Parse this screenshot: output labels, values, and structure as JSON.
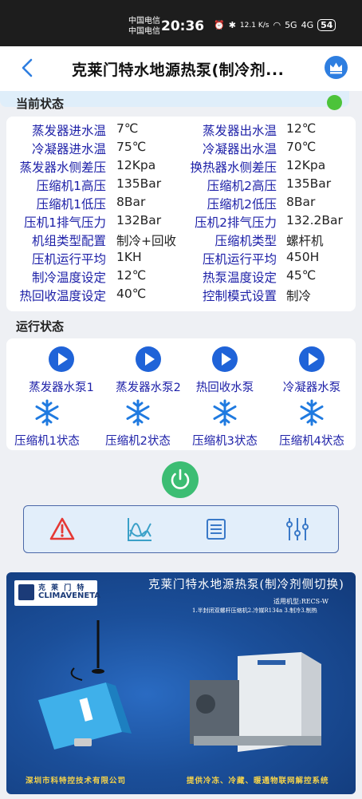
{
  "status_bar": {
    "carrier1": "中国电信",
    "carrier2": "中国电信",
    "time": "20:36",
    "net_speed": "12.1 K/s",
    "signal1": "5G",
    "signal2": "4G",
    "battery": "54"
  },
  "header": {
    "title": "克莱门特水地源热泵(制冷剂..."
  },
  "current_status": {
    "heading": "当前状态",
    "indicator_color": "#4cc33a",
    "rows": [
      {
        "l_label": "蒸发器进水温",
        "l_value": "7℃",
        "r_label": "蒸发器出水温",
        "r_value": "12℃"
      },
      {
        "l_label": "冷凝器进水温",
        "l_value": "75℃",
        "r_label": "冷凝器出水温",
        "r_value": "70℃"
      },
      {
        "l_label": "蒸发器水侧差压",
        "l_value": "12Kpa",
        "r_label": "换热器水侧差压",
        "r_value": "12Kpa"
      },
      {
        "l_label": "压缩机1高压",
        "l_value": "135Bar",
        "r_label": "压缩机2高压",
        "r_value": "135Bar"
      },
      {
        "l_label": "压缩机1低压",
        "l_value": "8Bar",
        "r_label": "压缩机2低压",
        "r_value": "8Bar"
      },
      {
        "l_label": "压机1排气压力",
        "l_value": "132Bar",
        "r_label": "压机2排气压力",
        "r_value": "132.2Bar"
      },
      {
        "l_label": "机组类型配置",
        "l_value": "制冷+回收",
        "r_label": "压缩机类型",
        "r_value": "螺杆机"
      },
      {
        "l_label": "压机运行平均",
        "l_value": "1KH",
        "r_label": "压机运行平均",
        "r_value": "450H"
      },
      {
        "l_label": "制冷温度设定",
        "l_value": "12℃",
        "r_label": "热泵温度设定",
        "r_value": "45℃"
      },
      {
        "l_label": "热回收温度设定",
        "l_value": "40℃",
        "r_label": "控制模式设置",
        "r_value": "制冷"
      }
    ]
  },
  "run_status": {
    "heading": "运行状态",
    "pumps": [
      {
        "label": "蒸发器水泵1",
        "icon": "play-icon"
      },
      {
        "label": "蒸发器水泵2",
        "icon": "play-icon"
      },
      {
        "label": "热回收水泵",
        "icon": "play-icon"
      },
      {
        "label": "冷凝器水泵",
        "icon": "play-icon"
      }
    ],
    "compressors": [
      {
        "label": "压缩机1状态",
        "icon": "snowflake-icon"
      },
      {
        "label": "压缩机2状态",
        "icon": "snowflake-icon"
      },
      {
        "label": "压缩机3状态",
        "icon": "snowflake-icon"
      },
      {
        "label": "压缩机4状态",
        "icon": "snowflake-icon"
      }
    ]
  },
  "controls": {
    "power": "power-icon",
    "tools": [
      "alarm-icon",
      "trend-chart-icon",
      "list-icon",
      "settings-sliders-icon"
    ]
  },
  "banner": {
    "logo_cn": "克 莱 门 特",
    "logo_en": "CLIMAVENETA",
    "title": "克莱门特水地源热泵(制冷剂侧切换)",
    "model": "适用机型:RECS-W",
    "spec": "1.半封闭双螺杆压缩机2.冷媒R134a 3.制冷3.制热",
    "footer_left": "深圳市科特控技术有限公司",
    "footer_right": "提供冷冻、冷藏、暖通物联网解控系统"
  }
}
